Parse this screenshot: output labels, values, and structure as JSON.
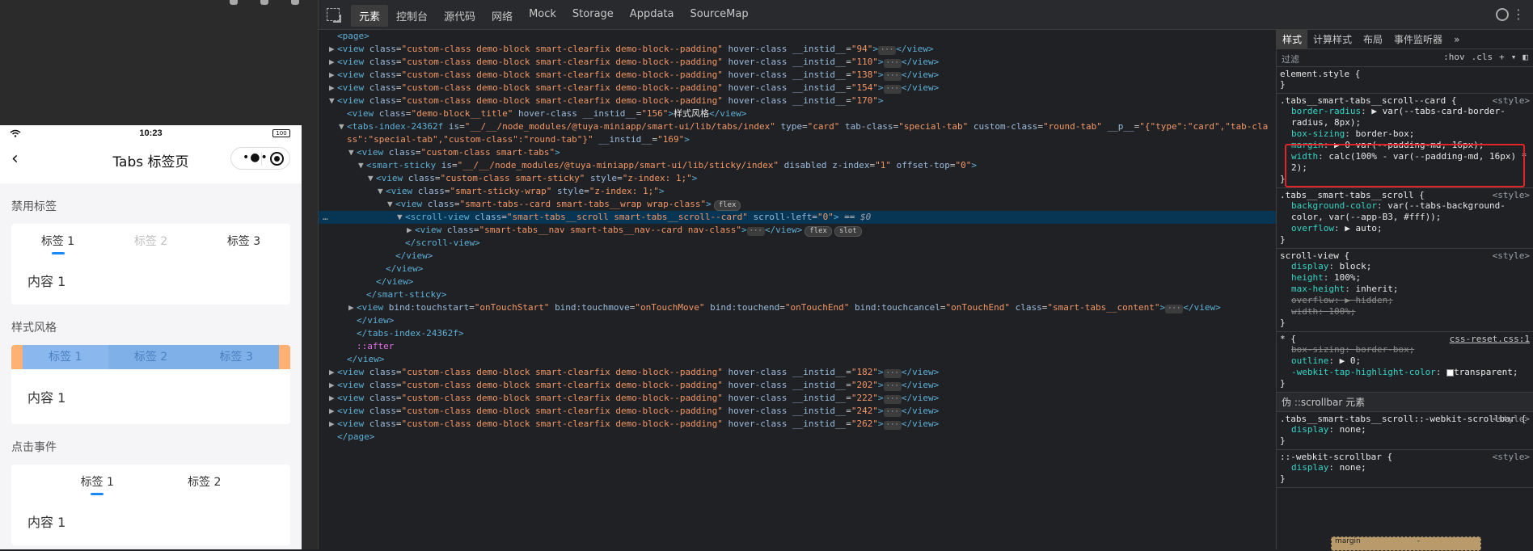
{
  "simulator": {
    "status_time": "10:23",
    "battery": "100",
    "nav_title": "Tabs 标签页",
    "capsule_dots": "•●•",
    "sections": [
      {
        "title": "禁用标签",
        "tabs": [
          "标签 1",
          "标签 2",
          "标签 3"
        ],
        "content": "内容 1"
      },
      {
        "title": "样式风格",
        "tabs": [
          "标签 1",
          "标签 2",
          "标签 3"
        ],
        "content": "内容 1"
      },
      {
        "title": "点击事件",
        "tabs": [
          "标签 1",
          "标签 2"
        ],
        "content": "内容 1"
      }
    ]
  },
  "devtools": {
    "tabs": [
      "元素",
      "控制台",
      "源代码",
      "网络",
      "Mock",
      "Storage",
      "Appdata",
      "SourceMap"
    ],
    "active_tab": "元素"
  },
  "elements": {
    "lines": [
      {
        "indent": 0,
        "tri": "",
        "html": "<span class='tag'>&lt;page&gt;</span>"
      },
      {
        "indent": 0,
        "tri": "▶",
        "instid": "94"
      },
      {
        "indent": 0,
        "tri": "▶",
        "instid": "110"
      },
      {
        "indent": 0,
        "tri": "▶",
        "instid": "138"
      },
      {
        "indent": 0,
        "tri": "▶",
        "instid": "154"
      },
      {
        "indent": 0,
        "tri": "▼",
        "instid": "170",
        "open": true
      },
      {
        "indent": 1,
        "tri": "",
        "html": "<span class='tag'>&lt;view</span> <span class='attr'>class</span>=<span class='val'>\"demo-block__title\"</span> <span class='attr'>hover-class</span> <span class='attr'>__instid__</span>=<span class='val'>\"156\"</span><span class='tag'>&gt;</span><span class='txt'>样式风格</span><span class='tag'>&lt;/view&gt;</span>"
      },
      {
        "indent": 1,
        "tri": "▼",
        "html": "<span class='tag'>&lt;tabs-index-24362f</span> <span class='attr'>is</span>=<span class='val'>\"__/__/node_modules/@tuya-miniapp/smart-ui/lib/tabs/index\"</span> <span class='attr'>type</span>=<span class='val'>\"card\"</span> <span class='attr'>tab-class</span>=<span class='val'>\"special-tab\"</span> <span class='attr'>custom-class</span>=<span class='val'>\"round-tab\"</span> <span class='attr'>__p__</span>=<span class='val'>\"{\"type\":\"card\",\"tab-cla</span>"
      },
      {
        "indent": 1,
        "tri": "",
        "html": "<span class='val'>ss\":\"special-tab\",\"custom-class\":\"round-tab\"}\"</span> <span class='attr'>__instid__</span>=<span class='val'>\"169\"</span><span class='tag'>&gt;</span>"
      },
      {
        "indent": 2,
        "tri": "▼",
        "html": "<span class='tag'>&lt;view</span> <span class='attr'>class</span>=<span class='val'>\"custom-class smart-tabs\"</span><span class='tag'>&gt;</span>"
      },
      {
        "indent": 3,
        "tri": "▼",
        "html": "<span class='tag'>&lt;smart-sticky</span> <span class='attr'>is</span>=<span class='val'>\"__/__/node_modules/@tuya-miniapp/smart-ui/lib/sticky/index\"</span> <span class='attr'>disabled</span> <span class='attr'>z-index</span>=<span class='val'>\"1\"</span> <span class='attr'>offset-top</span>=<span class='val'>\"0\"</span><span class='tag'>&gt;</span>"
      },
      {
        "indent": 4,
        "tri": "▼",
        "html": "<span class='tag'>&lt;view</span> <span class='attr'>class</span>=<span class='val'>\"custom-class smart-sticky\"</span> <span class='attr'>style</span>=<span class='val'>\"z-index: 1;\"</span><span class='tag'>&gt;</span>"
      },
      {
        "indent": 5,
        "tri": "▼",
        "html": "<span class='tag'>&lt;view</span> <span class='attr'>class</span>=<span class='val'>\"smart-sticky-wrap\"</span> <span class='attr'>style</span>=<span class='val'>\"z-index: 1;\"</span><span class='tag'>&gt;</span>"
      },
      {
        "indent": 6,
        "tri": "▼",
        "html": "<span class='tag'>&lt;view</span> <span class='attr'>class</span>=<span class='val'>\"smart-tabs--card smart-tabs__wrap  wrap-class\"</span><span class='tag'>&gt;</span><span class='badge'>flex</span>"
      },
      {
        "indent": 7,
        "tri": "▼",
        "selected": true,
        "html": "<span class='tag'>&lt;scroll-view</span> <span class='attr'>class</span>=<span class='val'>\"smart-tabs__scroll smart-tabs__scroll--card\"</span> <span class='attr'>scroll-left</span>=<span class='val'>\"0\"</span><span class='tag'>&gt;</span> == <span class='dollar'>$0</span>"
      },
      {
        "indent": 8,
        "tri": "▶",
        "html": "<span class='tag'>&lt;view</span> <span class='attr'>class</span>=<span class='val'>\"smart-tabs__nav smart-tabs__nav--card nav-class\"</span><span class='tag'>&gt;</span><span class='ellipsis'>···</span><span class='tag'>&lt;/view&gt;</span><span class='badge'>flex</span><span class='badge'>slot</span>"
      },
      {
        "indent": 7,
        "tri": "",
        "html": "<span class='tag'>&lt;/scroll-view&gt;</span>"
      },
      {
        "indent": 6,
        "tri": "",
        "html": "<span class='tag'>&lt;/view&gt;</span>"
      },
      {
        "indent": 5,
        "tri": "",
        "html": "<span class='tag'>&lt;/view&gt;</span>"
      },
      {
        "indent": 4,
        "tri": "",
        "html": "<span class='tag'>&lt;/view&gt;</span>"
      },
      {
        "indent": 3,
        "tri": "",
        "html": "<span class='tag'>&lt;/smart-sticky&gt;</span>"
      },
      {
        "indent": 2,
        "tri": "▶",
        "html": "<span class='tag'>&lt;view</span> <span class='attr'>bind:touchstart</span>=<span class='val'>\"onTouchStart\"</span> <span class='attr'>bind:touchmove</span>=<span class='val'>\"onTouchMove\"</span> <span class='attr'>bind:touchend</span>=<span class='val'>\"onTouchEnd\"</span> <span class='attr'>bind:touchcancel</span>=<span class='val'>\"onTouchEnd\"</span> <span class='attr'>class</span>=<span class='val'>\"smart-tabs__content\"</span><span class='tag'>&gt;</span><span class='ellipsis'>···</span><span class='tag'>&lt;/view&gt;</span>"
      },
      {
        "indent": 2,
        "tri": "",
        "html": "<span class='tag'>&lt;/view&gt;</span>"
      },
      {
        "indent": 2,
        "tri": "",
        "html": "<span class='tag'>&lt;/tabs-index-24362f&gt;</span>"
      },
      {
        "indent": 2,
        "tri": "",
        "html": "<span class='pseudo'>::after</span>"
      },
      {
        "indent": 1,
        "tri": "",
        "html": "<span class='tag'>&lt;/view&gt;</span>"
      },
      {
        "indent": 0,
        "tri": "▶",
        "instid": "182"
      },
      {
        "indent": 0,
        "tri": "▶",
        "instid": "202"
      },
      {
        "indent": 0,
        "tri": "▶",
        "instid": "222"
      },
      {
        "indent": 0,
        "tri": "▶",
        "instid": "242"
      },
      {
        "indent": 0,
        "tri": "▶",
        "instid": "262"
      },
      {
        "indent": 0,
        "tri": "",
        "html": "<span class='tag'>&lt;/page&gt;</span>"
      }
    ],
    "demo_block_class": "custom-class demo-block smart-clearfix demo-block--padding"
  },
  "styles": {
    "tabs": [
      "样式",
      "计算样式",
      "布局",
      "事件监听器",
      "»"
    ],
    "filter_placeholder": "过滤",
    "tools": [
      ":hov",
      ".cls",
      "+"
    ],
    "rules": [
      {
        "selector": "element.style {",
        "src": "",
        "props": []
      },
      {
        "selector": ".tabs__smart-tabs__scroll--card {",
        "src": "<style>",
        "props": [
          [
            "border-radius",
            "▶ var(--tabs-card-border-radius, 8px);",
            false
          ],
          [
            "box-sizing",
            "border-box;",
            false
          ],
          [
            "margin",
            "▶ 0 var(--padding-md, 16px);",
            false
          ],
          [
            "width",
            "calc(100% - var(--padding-md, 16px) * 2);",
            false
          ]
        ]
      },
      {
        "selector": ".tabs__smart-tabs__scroll {",
        "src": "<style>",
        "props": [
          [
            "background-color",
            "var(--tabs-background-color, var(--app-B3, #fff));",
            false
          ],
          [
            "overflow",
            "▶ auto;",
            false
          ]
        ]
      },
      {
        "selector": "scroll-view {",
        "src": "<style>",
        "props": [
          [
            "display",
            "block;",
            false
          ],
          [
            "height",
            "100%;",
            false
          ],
          [
            "max-height",
            "inherit;",
            false
          ],
          [
            "overflow",
            "▶ hidden;",
            true
          ],
          [
            "width",
            "100%;",
            true
          ]
        ]
      },
      {
        "selector": "* {",
        "src": "css-reset.css:1",
        "props": [
          [
            "box-sizing",
            "border-box;",
            true
          ],
          [
            "outline",
            "▶ 0;",
            false
          ],
          [
            "-webkit-tap-highlight-color",
            "transparent;",
            false
          ]
        ]
      }
    ],
    "pseudo_header": "伪 ::scrollbar 元素",
    "pseudo_rules": [
      {
        "selector": ".tabs__smart-tabs__scroll::-webkit-scrollbar {",
        "src": "<style>",
        "props": [
          [
            "display",
            "none;",
            false
          ]
        ]
      },
      {
        "selector": "::-webkit-scrollbar {",
        "src": "<style>",
        "props": [
          [
            "display",
            "none;",
            false
          ]
        ]
      }
    ],
    "box_model_label": "margin",
    "box_model_value": "-"
  }
}
